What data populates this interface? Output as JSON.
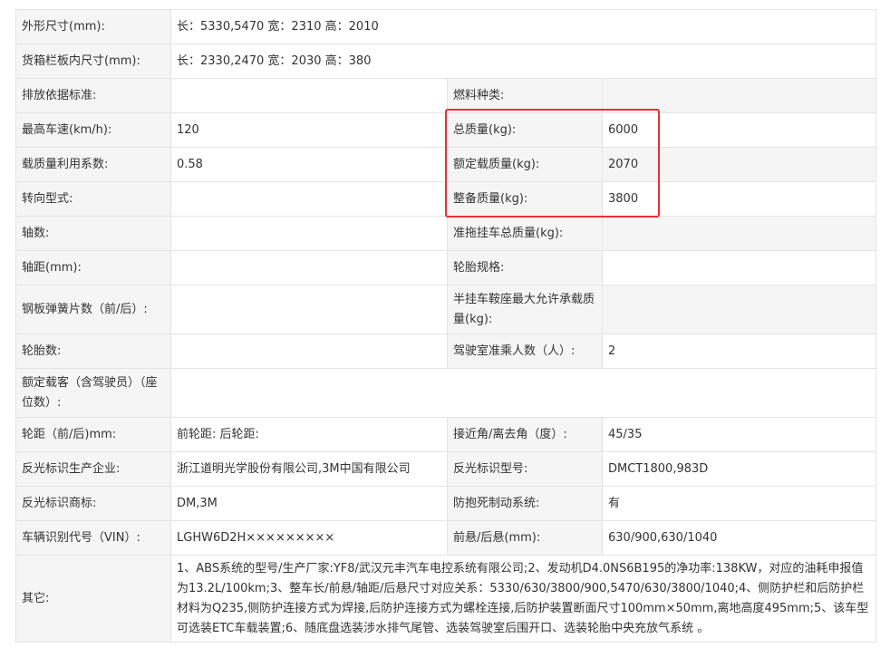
{
  "highlight_color": "#e8303a",
  "rows": {
    "r1": {
      "l1": "外形尺寸(mm):",
      "v1": "长：5330,5470 宽：2310 高：2010"
    },
    "r2": {
      "l1": "货箱栏板内尺寸(mm):",
      "v1": "长：2330,2470 宽：2030 高：380"
    },
    "r3": {
      "l1": "排放依据标准:",
      "v1": "",
      "l2": "燃料种类:",
      "v2": ""
    },
    "r4": {
      "l1": "最高车速(km/h):",
      "v1": "120",
      "l2": "总质量(kg):",
      "v2": "6000"
    },
    "r5": {
      "l1": "载质量利用系数:",
      "v1": "0.58",
      "l2": "额定载质量(kg):",
      "v2": "2070"
    },
    "r6": {
      "l1": "转向型式:",
      "v1": "",
      "l2": "整备质量(kg):",
      "v2": "3800"
    },
    "r7": {
      "l1": "轴数:",
      "v1": "",
      "l2": "准拖挂车总质量(kg):",
      "v2": ""
    },
    "r8": {
      "l1": "轴距(mm):",
      "v1": "",
      "l2": "轮胎规格:",
      "v2": ""
    },
    "r9": {
      "l1": "钢板弹簧片数（前/后）:",
      "v1": "",
      "l2": "半挂车鞍座最大允许承载质量(kg):",
      "v2": ""
    },
    "r10": {
      "l1": "轮胎数:",
      "v1": "",
      "l2": "驾驶室准乘人数（人）:",
      "v2": "2"
    },
    "r11": {
      "l1": "额定载客（含驾驶员）（座位数）:",
      "v1": ""
    },
    "r12": {
      "l1": "轮距（前/后)mm:",
      "v1": "前轮距: 后轮距:",
      "l2": "接近角/离去角（度）:",
      "v2": "45/35"
    },
    "r13": {
      "l1": "反光标识生产企业:",
      "v1": "浙江道明光学股份有限公司,3M中国有限公司",
      "l2": "反光标识型号:",
      "v2": "DMCT1800,983D"
    },
    "r14": {
      "l1": "反光标识商标:",
      "v1": "DM,3M",
      "l2": "防抱死制动系统:",
      "v2": "有"
    },
    "r15": {
      "l1": "车辆识别代号（VIN）:",
      "v1": "LGHW6D2H×××××××××",
      "l2": "前悬/后悬(mm):",
      "v2": "630/900,630/1040"
    },
    "r16": {
      "l1": "其它:",
      "v1": "1、ABS系统的型号/生产厂家:YF8/武汉元丰汽车电控系统有限公司;2、发动机D4.0NS6B195的净功率:138KW，对应的油耗申报值为13.2L/100km;3、整车长/前悬/轴距/后悬尺寸对应关系：5330/630/3800/900,5470/630/3800/1040;4、侧防护栏和后防护栏材料为Q235,侧防护连接方式为焊接,后防护连接方式为螺栓连接,后防护装置断面尺寸100mm×50mm,离地高度495mm;5、该车型可选装ETC车载装置;6、随底盘选装涉水排气尾管、选装驾驶室后围开口、选装轮胎中央充放气系统 。"
    }
  }
}
